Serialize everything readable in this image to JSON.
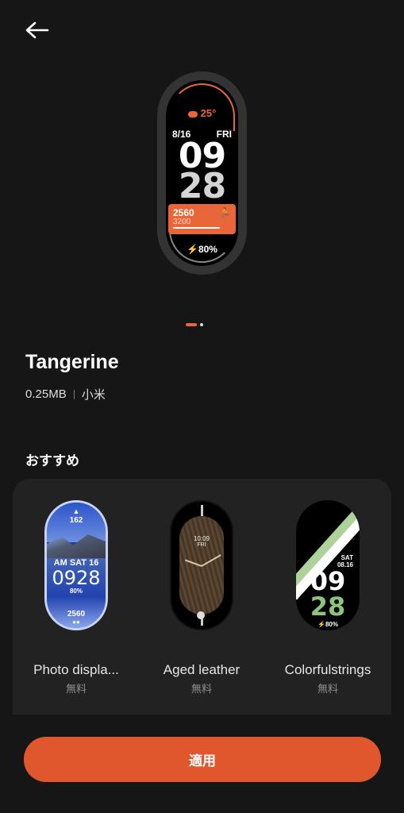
{
  "nav": {
    "back_icon": "arrow-left-icon"
  },
  "preview": {
    "weather": "25°",
    "date": "8/16",
    "weekday": "FRI",
    "hour": "09",
    "minute": "28",
    "steps": "2560",
    "steps_goal": "3200",
    "battery": "80%",
    "page_count": 2,
    "current_page": 1,
    "colors": {
      "accent": "#e8663a"
    }
  },
  "watchface": {
    "name": "Tangerine",
    "size": "0.25MB",
    "author": "小米"
  },
  "recommendations": {
    "title": "おすすめ",
    "items": [
      {
        "name": "Photo displa...",
        "price": "無料",
        "face": {
          "top": "162",
          "ampm": "AM",
          "day": "SAT",
          "date": "16",
          "time": "0928",
          "battery": "80%",
          "steps": "2560"
        }
      },
      {
        "name": "Aged leather",
        "price": "無料",
        "face": {
          "time": "10:09",
          "day": "FRI"
        }
      },
      {
        "name": "Colorfulstrings",
        "price": "無料",
        "face": {
          "day": "SAT",
          "date": "08.16",
          "hour": "09",
          "minute": "28",
          "battery": "80%"
        }
      }
    ]
  },
  "apply_button": {
    "label": "適用"
  }
}
